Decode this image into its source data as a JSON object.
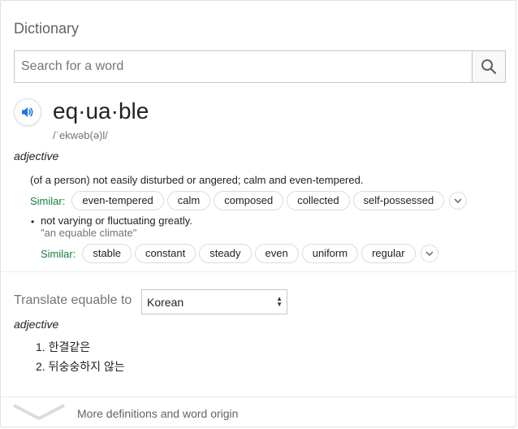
{
  "header": {
    "title": "Dictionary"
  },
  "search": {
    "placeholder": "Search for a word",
    "value": "",
    "button_icon": "search-icon"
  },
  "entry": {
    "word": "eq·ua·ble",
    "phonetic": "/ˈekwəb(ə)l/",
    "part_of_speech": "adjective",
    "senses": [
      {
        "definition": "(of a person) not easily disturbed or angered; calm and even-tempered.",
        "similar_label": "Similar:",
        "similar": [
          "even-tempered",
          "calm",
          "composed",
          "collected",
          "self-possessed"
        ]
      },
      {
        "definition": "not varying or fluctuating greatly.",
        "example": "\"an equable climate\"",
        "similar_label": "Similar:",
        "similar": [
          "stable",
          "constant",
          "steady",
          "even",
          "uniform",
          "regular"
        ]
      }
    ]
  },
  "translate": {
    "label": "Translate equable to",
    "selected_language": "Korean",
    "part_of_speech": "adjective",
    "items": [
      "1. 한결같은",
      "2. 뒤숭숭하지 않는"
    ]
  },
  "footer": {
    "more_label": "More definitions and word origin"
  },
  "colors": {
    "similar_green": "#188038",
    "speaker_blue": "#1a73e8",
    "border": "#dadce0"
  }
}
